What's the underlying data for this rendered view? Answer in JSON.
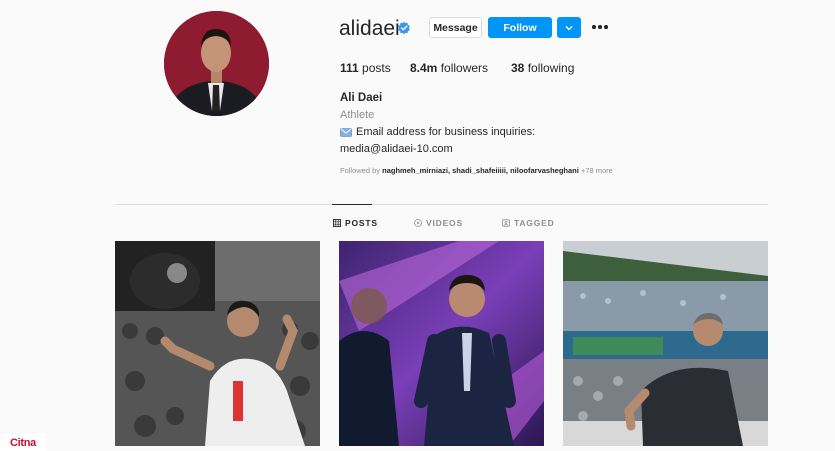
{
  "profile": {
    "username": "alidaei",
    "message_label": "Message",
    "follow_label": "Follow",
    "posts_count": "111",
    "posts_label": "posts",
    "followers_count": "8.4m",
    "followers_label": "followers",
    "following_count": "38",
    "following_label": "following",
    "full_name": "Ali Daei",
    "category": "Athlete",
    "bio_line1": "Email address for business inquiries:",
    "bio_line2": "media@alidaei-10.com",
    "followed_by_prefix": "Followed by",
    "followed_by_names": "naghmeh_mirniazi, shadi_shafeiiiii, niloofarvasheghani",
    "followed_by_more": "+78 more"
  },
  "tabs": [
    {
      "label": "POSTS",
      "icon": "grid-icon",
      "active": true
    },
    {
      "label": "VIDEOS",
      "icon": "play-icon",
      "active": false
    },
    {
      "label": "TAGGED",
      "icon": "tag-icon",
      "active": false
    }
  ],
  "watermark": "Citna",
  "colors": {
    "accent": "#0095f6",
    "verified": "#3897f0",
    "watermark": "#c8102e"
  }
}
